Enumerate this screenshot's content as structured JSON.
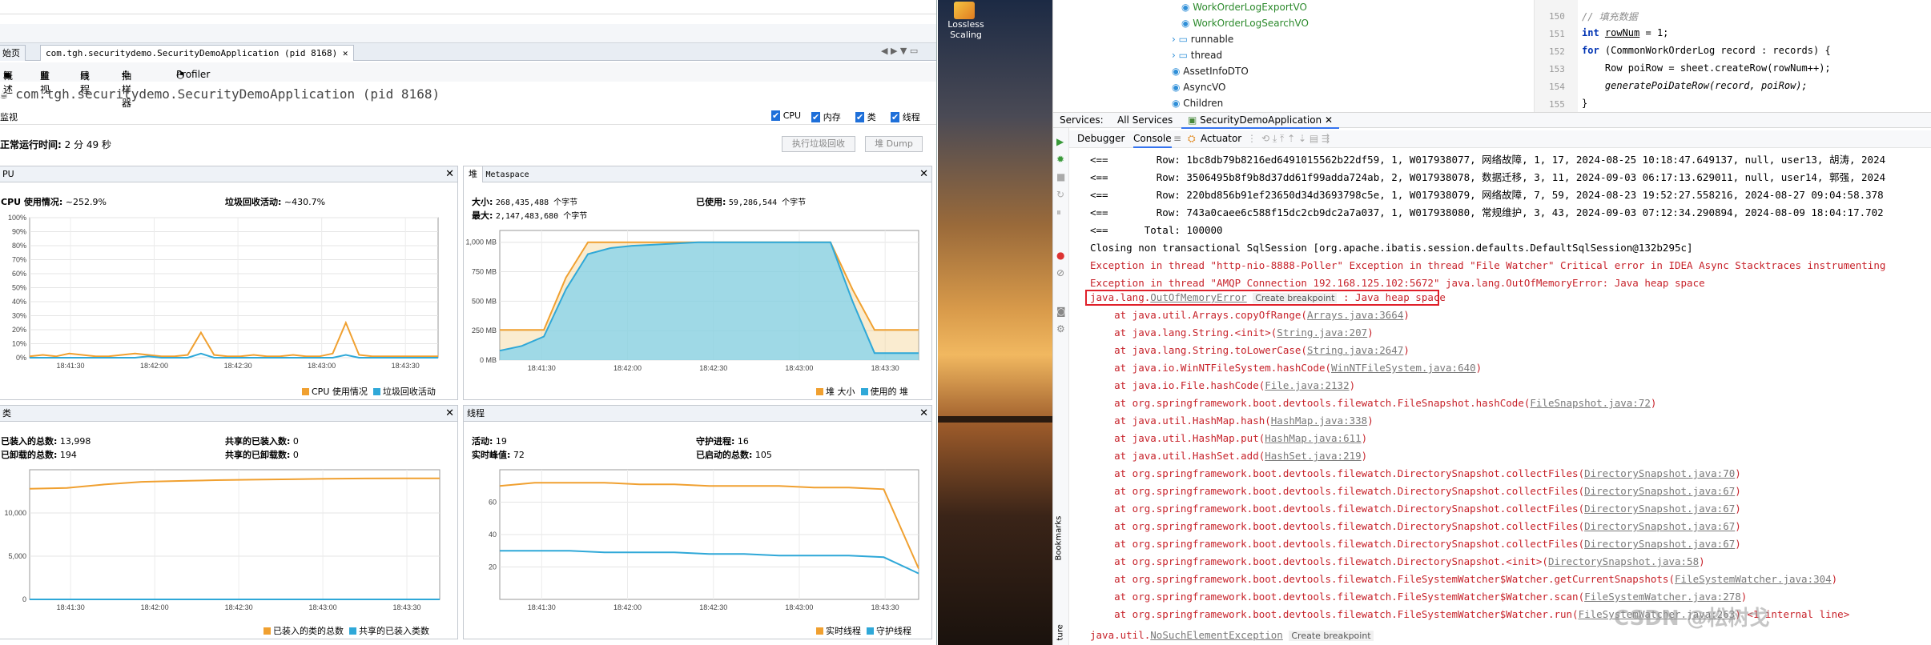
{
  "visualvm": {
    "tabs": [
      "始页",
      "com.tgh.securitydemo.SecurityDemoApplication (pid 8168)"
    ],
    "subtabs": [
      "概述",
      "监视",
      "线程",
      "抽样器",
      "Profiler"
    ],
    "app_title": "com.tgh.securitydemo.SecurityDemoApplication (pid 8168)",
    "section": "监视",
    "checks": [
      "CPU",
      "内存",
      "类",
      "线程"
    ],
    "uptime_label": "正常运行时间:",
    "uptime_value": "2 分 49 秒",
    "gc_button": "执行垃圾回收",
    "heapdump_button": "堆 Dump",
    "cpu": {
      "title": "PU",
      "usage_label": "CPU 使用情况:",
      "usage_value": "~252.9%",
      "gc_label": "垃圾回收活动:",
      "gc_value": "~430.7%",
      "legend": [
        "CPU 使用情况",
        "垃圾回收活动"
      ],
      "colors": [
        "#f0a030",
        "#2fa8d8"
      ]
    },
    "heap": {
      "tab1": "堆",
      "tab2": "Metaspace",
      "size_label": "大小:",
      "size_value": "268,435,488 个字节",
      "max_label": "最大:",
      "max_value": "2,147,483,680 个字节",
      "used_label": "已使用:",
      "used_value": "59,286,544 个字节",
      "legend": [
        "堆 大小",
        "使用的 堆"
      ]
    },
    "classes": {
      "title": "类",
      "loaded_label": "已装入的总数:",
      "loaded_value": "13,998",
      "unloaded_label": "已卸载的总数:",
      "unloaded_value": "194",
      "shared_loaded_label": "共享的已装入数:",
      "shared_loaded_value": "0",
      "shared_unloaded_label": "共享的已卸载数:",
      "shared_unloaded_value": "0",
      "legend": [
        "已装入的类的总数",
        "共享的已装入类数"
      ]
    },
    "threads": {
      "title": "线程",
      "live_label": "活动:",
      "live_value": "19",
      "peak_label": "实时峰值:",
      "peak_value": "72",
      "daemon_label": "守护进程:",
      "daemon_value": "16",
      "started_label": "已启动的总数:",
      "started_value": "105",
      "legend": [
        "实时线程",
        "守护线程"
      ]
    },
    "x_ticks": [
      "18:41:30",
      "18:42:00",
      "18:42:30",
      "18:43:00",
      "18:43:30"
    ]
  },
  "chart_data": [
    {
      "type": "line",
      "title": "CPU",
      "y_ticks": [
        "0%",
        "10%",
        "20%",
        "30%",
        "40%",
        "50%",
        "60%",
        "70%",
        "80%",
        "90%",
        "100%"
      ],
      "ylim": [
        0,
        100
      ],
      "series": [
        {
          "name": "CPU 使用情况",
          "values": [
            1,
            2,
            1,
            3,
            2,
            1,
            1,
            2,
            3,
            2,
            1,
            1,
            2,
            18,
            2,
            1,
            1,
            2,
            1,
            1,
            2,
            1,
            1,
            3,
            25,
            2,
            1,
            1,
            1,
            1,
            1,
            1
          ]
        },
        {
          "name": "垃圾回收活动",
          "values": [
            0,
            0,
            0,
            0,
            0,
            0,
            0,
            0,
            0,
            1,
            0,
            0,
            0,
            3,
            0,
            0,
            0,
            0,
            0,
            0,
            0,
            0,
            0,
            0,
            2,
            0,
            0,
            0,
            0,
            0,
            0,
            0
          ]
        }
      ]
    },
    {
      "type": "area",
      "title": "堆",
      "y_ticks": [
        "0 MB",
        "250 MB",
        "500 MB",
        "750 MB",
        "1,000 MB"
      ],
      "ylim": [
        0,
        1100
      ],
      "series": [
        {
          "name": "堆 大小",
          "values": [
            256,
            256,
            256,
            700,
            1000,
            1000,
            1000,
            1000,
            1000,
            1000,
            1000,
            1000,
            1000,
            1000,
            1000,
            1000,
            600,
            256,
            256,
            256
          ]
        },
        {
          "name": "使用的 堆",
          "values": [
            80,
            120,
            200,
            600,
            900,
            950,
            970,
            980,
            990,
            1000,
            1000,
            1000,
            1000,
            1000,
            1000,
            1000,
            500,
            60,
            60,
            60
          ]
        }
      ]
    },
    {
      "type": "line",
      "title": "类",
      "y_ticks": [
        "0",
        "5,000",
        "10,000"
      ],
      "ylim": [
        0,
        15000
      ],
      "series": [
        {
          "name": "已装入的类的总数",
          "values": [
            12800,
            12900,
            13300,
            13600,
            13700,
            13800,
            13850,
            13900,
            13950,
            13990,
            13998,
            13998
          ]
        },
        {
          "name": "共享的已装入类数",
          "values": [
            0,
            0,
            0,
            0,
            0,
            0,
            0,
            0,
            0,
            0,
            0,
            0
          ]
        }
      ]
    },
    {
      "type": "line",
      "title": "线程",
      "y_ticks": [
        "20",
        "40",
        "60"
      ],
      "ylim": [
        0,
        80
      ],
      "series": [
        {
          "name": "实时线程",
          "values": [
            70,
            72,
            72,
            72,
            71,
            71,
            70,
            70,
            70,
            69,
            69,
            68,
            19
          ]
        },
        {
          "name": "守护线程",
          "values": [
            30,
            30,
            30,
            29,
            29,
            29,
            28,
            28,
            27,
            27,
            27,
            26,
            16
          ]
        }
      ]
    }
  ],
  "wallpaper": {
    "icon_label_1": "Lossless",
    "icon_label_2": "Scaling"
  },
  "ide": {
    "tree": [
      {
        "label": "WorkOrderLogExportVO",
        "green": true
      },
      {
        "label": "WorkOrderLogSearchVO",
        "green": true
      },
      {
        "label": "runnable",
        "green": false
      },
      {
        "label": "thread",
        "green": false
      },
      {
        "label": "AssetInfoDTO",
        "green": false
      },
      {
        "label": "AsyncVO",
        "green": false
      },
      {
        "label": "Children",
        "green": false
      }
    ],
    "line_numbers": [
      "150",
      "151",
      "152",
      "153",
      "154",
      "155"
    ],
    "code": {
      "c1": "// 填充数据",
      "c2a": "int ",
      "c2b": "rowNum",
      "c2c": " = 1;",
      "c3a": "for ",
      "c3b": "(CommonWorkOrderLog record : records) {",
      "c4": "    Row poiRow = sheet.createRow(rowNum++);",
      "c5": "    generatePoiDateRow(record, poiRow);",
      "c6": "}"
    },
    "services_label": "Services:",
    "all_services": "All Services",
    "app_tab": "SecurityDemoApplication",
    "debug_tabs": [
      "Debugger",
      "Console",
      "Actuator"
    ],
    "console_lines": [
      {
        "t": "<==        Row: 1bc8db79b8216ed6491015562b22df59, 1, W017938077, 网络故障, 1, 17, 2024-08-25 10:18:47.649137, null, user13, 胡涛, 2024",
        "c": ""
      },
      {
        "t": "<==        Row: 3506495b8f9b8d37dd61f99adda724ab, 2, W017938078, 数据迁移, 3, 11, 2024-09-03 06:17:13.629011, null, user14, 郭强, 2024",
        "c": ""
      },
      {
        "t": "<==        Row: 220bd856b91ef23650d34d3693798c5e, 1, W017938079, 网络故障, 7, 59, 2024-08-23 19:52:27.558216, 2024-08-27 09:04:58.378",
        "c": ""
      },
      {
        "t": "<==        Row: 743a0caee6c588f15dc2cb9dc2a7a037, 1, W017938080, 常规维护, 3, 43, 2024-09-03 07:12:34.290894, 2024-08-09 18:04:17.702",
        "c": ""
      },
      {
        "t": "<==      Total: 100000",
        "c": ""
      },
      {
        "t": "Closing non transactional SqlSession [org.apache.ibatis.session.defaults.DefaultSqlSession@132b295c]",
        "c": ""
      },
      {
        "t": "Exception in thread \"http-nio-8888-Poller\" Exception in thread \"File Watcher\" Critical error in IDEA Async Stacktraces instrumenting",
        "c": "err"
      },
      {
        "t": "Exception in thread \"AMQP Connection 192.168.125.102:5672\" java.lang.OutOfMemoryError: Java heap space",
        "c": "err"
      }
    ],
    "oom_prefix": "java.lang.",
    "oom_link": "OutOfMemoryError",
    "create_bp": "Create breakpoint",
    "oom_suffix": " : Java heap space",
    "stack": [
      {
        "a": "    at java.util.Arrays.copyOfRange(",
        "l": "Arrays.java:3664",
        "b": ")"
      },
      {
        "a": "    at java.lang.String.<init>(",
        "l": "String.java:207",
        "b": ")"
      },
      {
        "a": "    at java.lang.String.toLowerCase(",
        "l": "String.java:2647",
        "b": ")"
      },
      {
        "a": "    at java.io.WinNTFileSystem.hashCode(",
        "l": "WinNTFileSystem.java:640",
        "b": ")"
      },
      {
        "a": "    at java.io.File.hashCode(",
        "l": "File.java:2132",
        "b": ")"
      },
      {
        "a": "    at org.springframework.boot.devtools.filewatch.FileSnapshot.hashCode(",
        "l": "FileSnapshot.java:72",
        "b": ")"
      },
      {
        "a": "    at java.util.HashMap.hash(",
        "l": "HashMap.java:338",
        "b": ")"
      },
      {
        "a": "    at java.util.HashMap.put(",
        "l": "HashMap.java:611",
        "b": ")"
      },
      {
        "a": "    at java.util.HashSet.add(",
        "l": "HashSet.java:219",
        "b": ")"
      },
      {
        "a": "    at org.springframework.boot.devtools.filewatch.DirectorySnapshot.collectFiles(",
        "l": "DirectorySnapshot.java:70",
        "b": ")"
      },
      {
        "a": "    at org.springframework.boot.devtools.filewatch.DirectorySnapshot.collectFiles(",
        "l": "DirectorySnapshot.java:67",
        "b": ")"
      },
      {
        "a": "    at org.springframework.boot.devtools.filewatch.DirectorySnapshot.collectFiles(",
        "l": "DirectorySnapshot.java:67",
        "b": ")"
      },
      {
        "a": "    at org.springframework.boot.devtools.filewatch.DirectorySnapshot.collectFiles(",
        "l": "DirectorySnapshot.java:67",
        "b": ")"
      },
      {
        "a": "    at org.springframework.boot.devtools.filewatch.DirectorySnapshot.collectFiles(",
        "l": "DirectorySnapshot.java:67",
        "b": ")"
      },
      {
        "a": "    at org.springframework.boot.devtools.filewatch.DirectorySnapshot.<init>(",
        "l": "DirectorySnapshot.java:58",
        "b": ")"
      },
      {
        "a": "    at org.springframework.boot.devtools.filewatch.FileSystemWatcher$Watcher.getCurrentSnapshots(",
        "l": "FileSystemWatcher.java:304",
        "b": ")"
      },
      {
        "a": "    at org.springframework.boot.devtools.filewatch.FileSystemWatcher$Watcher.scan(",
        "l": "FileSystemWatcher.java:278",
        "b": ")"
      },
      {
        "a": "    at org.springframework.boot.devtools.filewatch.FileSystemWatcher$Watcher.run(",
        "l": "FileSystemWatcher.java:263",
        "b": ") <1 internal line>"
      }
    ],
    "last_prefix": "java.util.",
    "last_link": "NoSuchElementException",
    "last_bp": "Create breakpoint",
    "side_labels": [
      "Bookmarks",
      "ture"
    ],
    "watermark": "CSDN @松树戈"
  }
}
